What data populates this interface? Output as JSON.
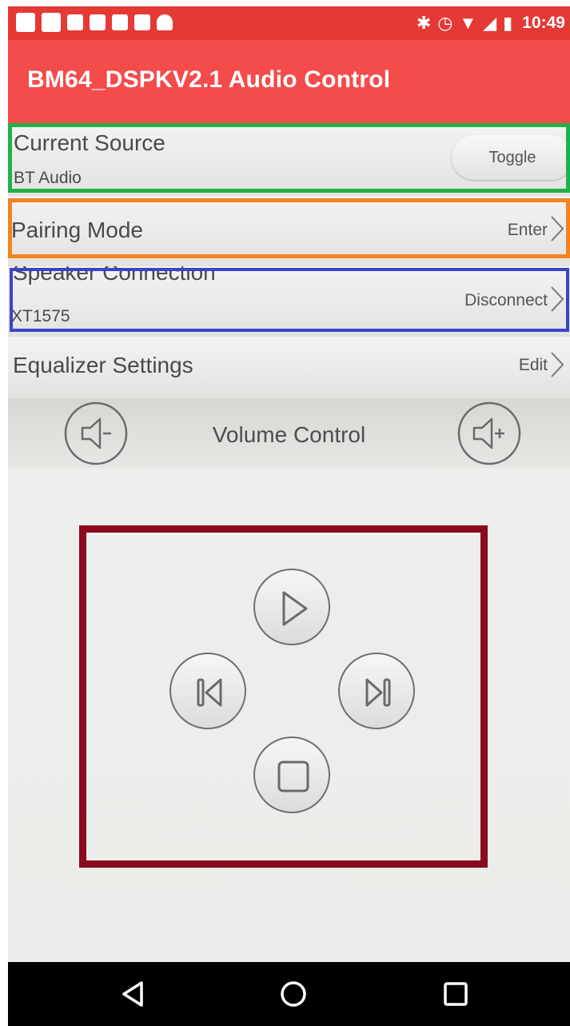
{
  "status_bar": {
    "left_icons": [
      "app-notification-icon",
      "gmail-icon",
      "image-icon",
      "office-icon",
      "book-icon",
      "check-icon",
      "android-icon"
    ],
    "right_icons": [
      "bluetooth-icon",
      "alarm-icon",
      "wifi-icon",
      "signal-icon",
      "battery-icon"
    ],
    "time": "10:49"
  },
  "app_bar": {
    "title": "BM64_DSPKV2.1 Audio Control",
    "color": "#f44b4b"
  },
  "current_source": {
    "label": "Current Source",
    "value": "BT Audio",
    "button": "Toggle",
    "outline_color": "#22b04a"
  },
  "pairing_mode": {
    "label": "Pairing Mode",
    "action": "Enter",
    "outline_color": "#f58220"
  },
  "speaker_connection": {
    "label": "Speaker Connection",
    "value": "XT1575",
    "action": "Disconnect",
    "outline_color": "#3a44c8"
  },
  "equalizer": {
    "label": "Equalizer Settings",
    "action": "Edit"
  },
  "volume": {
    "label": "Volume Control",
    "down_icon": "volume-down-icon",
    "up_icon": "volume-up-icon"
  },
  "playback": {
    "frame_color": "#8b0a1e",
    "buttons": [
      "play-icon",
      "previous-track-icon",
      "next-track-icon",
      "stop-icon"
    ]
  },
  "nav_bar": {
    "buttons": [
      "back-icon",
      "home-icon",
      "recents-icon"
    ]
  }
}
